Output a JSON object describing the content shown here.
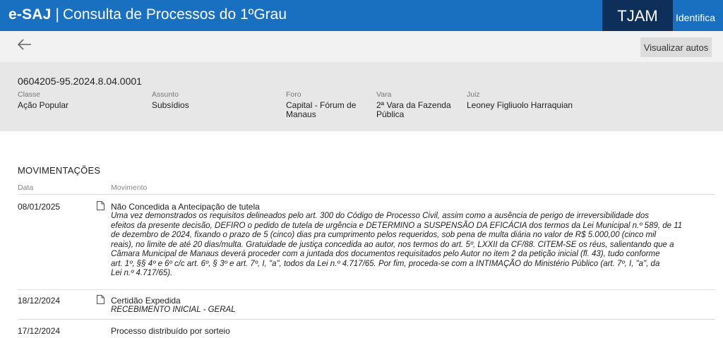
{
  "header": {
    "brand": "e-SAJ",
    "separator": "|",
    "title": "Consulta de Processos do 1ºGrau",
    "court": "TJAM",
    "identify_label": "Identifica"
  },
  "toolbar": {
    "back_icon": "arrow-left-icon",
    "view_records_label": "Visualizar autos"
  },
  "case": {
    "number": "0604205-95.2024.8.04.0001",
    "fields": {
      "classe": {
        "label": "Classe",
        "value": "Ação Popular"
      },
      "assunto": {
        "label": "Assunto",
        "value": "Subsídios"
      },
      "foro": {
        "label": "Foro",
        "value_line1": "Capital - Fórum de",
        "value_line2": "Manaus"
      },
      "vara": {
        "label": "Vara",
        "value_line1": "2ª Vara da Fazenda",
        "value_line2": "Pública"
      },
      "juiz": {
        "label": "Juiz",
        "value": "Leoney Figliuolo Harraquian"
      }
    }
  },
  "movements": {
    "title": "MOVIMENTAÇÕES",
    "col_date": "Data",
    "col_movement": "Movimento",
    "items": [
      {
        "date": "08/01/2025",
        "title": "Não Concedida a Antecipação de tutela",
        "desc_lines": [
          "Uma vez demonstrados os requisitos delineados pelo art. 300 do Código de Processo Civil, assim como a ausência de perigo de irreversibilidade dos",
          "efeitos da presente decisão, DEFIRO o pedido de tutela de urgência e DETERMINO a SUSPENSÃO DA EFICÁCIA dos termos da Lei Municipal n.º 589, de 11",
          "de dezembro de 2024, fixando o prazo de 5 (cinco) dias pra cumprimento pelos requeridos, sob pena de multa diária no valor de R$ 5.000,00 (cinco mil",
          "reais), no limite de até 20 dias/multa. Gratuidade de justiça concedida ao autor, nos termos do art. 5º, LXXII da CF/88. CITEM-SE os réus, salientando que a",
          "Câmara Municipal de Manaus deverá proceder com a juntada dos documentos requisitados pelo Autor no item 2 da petição inicial (fl. 43), tudo conforme",
          "art. 1º, §§ 4º e 6º c/c art. 6º, § 3º e art. 7º, I, \"a\", todos da Lei n.º 4.717/65. Por fim, proceda-se com a INTIMAÇÃO do Ministério Público (art. 7º, I, \"a\", da",
          "Lei n.º 4.717/65)."
        ]
      },
      {
        "date": "18/12/2024",
        "title": "Certidão Expedida",
        "desc": "RECEBIMENTO INICIAL - GERAL"
      },
      {
        "date": "17/12/2024",
        "title": "Processo distribuído por sorteio"
      }
    ]
  }
}
